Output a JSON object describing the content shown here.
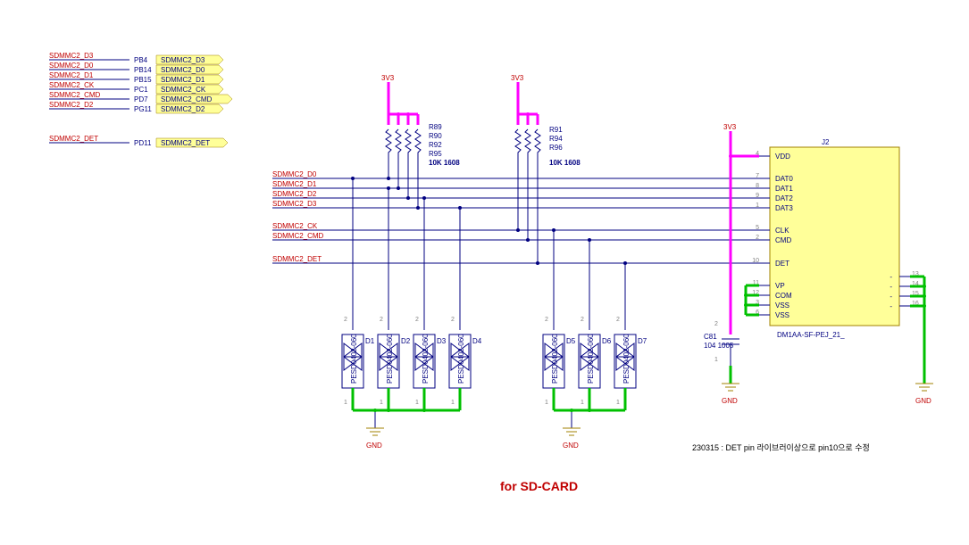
{
  "title": "for SD-CARD",
  "note": "230315 : DET pin 라이브러이상으로 pin10으로 수정",
  "power_rails": {
    "vcc": "3V3",
    "gnd": "GND"
  },
  "port_groups": {
    "left_ports": [
      {
        "net": "SDMMC2_D3",
        "pad": "PB4",
        "port": "SDMMC2_D3"
      },
      {
        "net": "SDMMC2_D0",
        "pad": "PB14",
        "port": "SDMMC2_D0"
      },
      {
        "net": "SDMMC2_D1",
        "pad": "PB15",
        "port": "SDMMC2_D1"
      },
      {
        "net": "SDMMC2_CK",
        "pad": "PC1",
        "port": "SDMMC2_CK"
      },
      {
        "net": "SDMMC2_CMD",
        "pad": "PD7",
        "port": "SDMMC2_CMD"
      },
      {
        "net": "SDMMC2_D2",
        "pad": "PG11",
        "port": "SDMMC2_D2"
      }
    ],
    "det_port": {
      "net": "SDMMC2_DET",
      "pad": "PD11",
      "port": "SDMMC2_DET"
    }
  },
  "resistors": {
    "group1": [
      "R89",
      "R90",
      "R92",
      "R95"
    ],
    "group2": [
      "R91",
      "R94",
      "R96"
    ],
    "value": "10K 1608"
  },
  "signal_nets": {
    "d0": "SDMMC2_D0",
    "d1": "SDMMC2_D1",
    "d2": "SDMMC2_D2",
    "d3": "SDMMC2_D3",
    "ck": "SDMMC2_CK",
    "cmd": "SDMMC2_CMD",
    "det": "SDMMC2_DET"
  },
  "tvs_diodes": {
    "group1": [
      "D1",
      "D2",
      "D3",
      "D4"
    ],
    "group2": [
      "D5",
      "D6",
      "D7"
    ],
    "part": "PESD0402-060"
  },
  "capacitor": {
    "ref": "C81",
    "value": "104 1005"
  },
  "connector": {
    "ref": "J2",
    "part": "DM1AA-SF-PEJ_21_",
    "pins": [
      {
        "num": "4",
        "name": "VDD"
      },
      {
        "num": "7",
        "name": "DAT0"
      },
      {
        "num": "8",
        "name": "DAT1"
      },
      {
        "num": "9",
        "name": "DAT2"
      },
      {
        "num": "1",
        "name": "DAT3"
      },
      {
        "num": "5",
        "name": "CLK"
      },
      {
        "num": "2",
        "name": "CMD"
      },
      {
        "num": "10",
        "name": "DET"
      },
      {
        "num": "11",
        "name": "VP"
      },
      {
        "num": "12",
        "name": "COM"
      },
      {
        "num": "3",
        "name": "VSS"
      },
      {
        "num": "6",
        "name": "VSS"
      }
    ],
    "right_pins": [
      "13",
      "14",
      "15",
      "16"
    ]
  }
}
